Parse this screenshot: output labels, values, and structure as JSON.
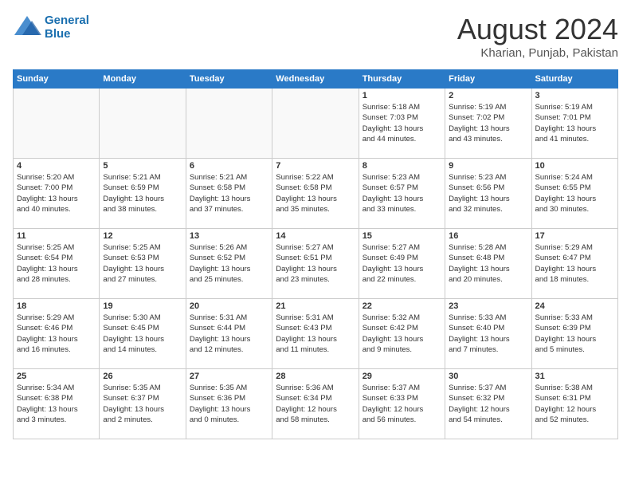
{
  "header": {
    "logo_line1": "General",
    "logo_line2": "Blue",
    "month_title": "August 2024",
    "location": "Kharian, Punjab, Pakistan"
  },
  "weekdays": [
    "Sunday",
    "Monday",
    "Tuesday",
    "Wednesday",
    "Thursday",
    "Friday",
    "Saturday"
  ],
  "weeks": [
    [
      {
        "day": "",
        "info": ""
      },
      {
        "day": "",
        "info": ""
      },
      {
        "day": "",
        "info": ""
      },
      {
        "day": "",
        "info": ""
      },
      {
        "day": "1",
        "info": "Sunrise: 5:18 AM\nSunset: 7:03 PM\nDaylight: 13 hours\nand 44 minutes."
      },
      {
        "day": "2",
        "info": "Sunrise: 5:19 AM\nSunset: 7:02 PM\nDaylight: 13 hours\nand 43 minutes."
      },
      {
        "day": "3",
        "info": "Sunrise: 5:19 AM\nSunset: 7:01 PM\nDaylight: 13 hours\nand 41 minutes."
      }
    ],
    [
      {
        "day": "4",
        "info": "Sunrise: 5:20 AM\nSunset: 7:00 PM\nDaylight: 13 hours\nand 40 minutes."
      },
      {
        "day": "5",
        "info": "Sunrise: 5:21 AM\nSunset: 6:59 PM\nDaylight: 13 hours\nand 38 minutes."
      },
      {
        "day": "6",
        "info": "Sunrise: 5:21 AM\nSunset: 6:58 PM\nDaylight: 13 hours\nand 37 minutes."
      },
      {
        "day": "7",
        "info": "Sunrise: 5:22 AM\nSunset: 6:58 PM\nDaylight: 13 hours\nand 35 minutes."
      },
      {
        "day": "8",
        "info": "Sunrise: 5:23 AM\nSunset: 6:57 PM\nDaylight: 13 hours\nand 33 minutes."
      },
      {
        "day": "9",
        "info": "Sunrise: 5:23 AM\nSunset: 6:56 PM\nDaylight: 13 hours\nand 32 minutes."
      },
      {
        "day": "10",
        "info": "Sunrise: 5:24 AM\nSunset: 6:55 PM\nDaylight: 13 hours\nand 30 minutes."
      }
    ],
    [
      {
        "day": "11",
        "info": "Sunrise: 5:25 AM\nSunset: 6:54 PM\nDaylight: 13 hours\nand 28 minutes."
      },
      {
        "day": "12",
        "info": "Sunrise: 5:25 AM\nSunset: 6:53 PM\nDaylight: 13 hours\nand 27 minutes."
      },
      {
        "day": "13",
        "info": "Sunrise: 5:26 AM\nSunset: 6:52 PM\nDaylight: 13 hours\nand 25 minutes."
      },
      {
        "day": "14",
        "info": "Sunrise: 5:27 AM\nSunset: 6:51 PM\nDaylight: 13 hours\nand 23 minutes."
      },
      {
        "day": "15",
        "info": "Sunrise: 5:27 AM\nSunset: 6:49 PM\nDaylight: 13 hours\nand 22 minutes."
      },
      {
        "day": "16",
        "info": "Sunrise: 5:28 AM\nSunset: 6:48 PM\nDaylight: 13 hours\nand 20 minutes."
      },
      {
        "day": "17",
        "info": "Sunrise: 5:29 AM\nSunset: 6:47 PM\nDaylight: 13 hours\nand 18 minutes."
      }
    ],
    [
      {
        "day": "18",
        "info": "Sunrise: 5:29 AM\nSunset: 6:46 PM\nDaylight: 13 hours\nand 16 minutes."
      },
      {
        "day": "19",
        "info": "Sunrise: 5:30 AM\nSunset: 6:45 PM\nDaylight: 13 hours\nand 14 minutes."
      },
      {
        "day": "20",
        "info": "Sunrise: 5:31 AM\nSunset: 6:44 PM\nDaylight: 13 hours\nand 12 minutes."
      },
      {
        "day": "21",
        "info": "Sunrise: 5:31 AM\nSunset: 6:43 PM\nDaylight: 13 hours\nand 11 minutes."
      },
      {
        "day": "22",
        "info": "Sunrise: 5:32 AM\nSunset: 6:42 PM\nDaylight: 13 hours\nand 9 minutes."
      },
      {
        "day": "23",
        "info": "Sunrise: 5:33 AM\nSunset: 6:40 PM\nDaylight: 13 hours\nand 7 minutes."
      },
      {
        "day": "24",
        "info": "Sunrise: 5:33 AM\nSunset: 6:39 PM\nDaylight: 13 hours\nand 5 minutes."
      }
    ],
    [
      {
        "day": "25",
        "info": "Sunrise: 5:34 AM\nSunset: 6:38 PM\nDaylight: 13 hours\nand 3 minutes."
      },
      {
        "day": "26",
        "info": "Sunrise: 5:35 AM\nSunset: 6:37 PM\nDaylight: 13 hours\nand 2 minutes."
      },
      {
        "day": "27",
        "info": "Sunrise: 5:35 AM\nSunset: 6:36 PM\nDaylight: 13 hours\nand 0 minutes."
      },
      {
        "day": "28",
        "info": "Sunrise: 5:36 AM\nSunset: 6:34 PM\nDaylight: 12 hours\nand 58 minutes."
      },
      {
        "day": "29",
        "info": "Sunrise: 5:37 AM\nSunset: 6:33 PM\nDaylight: 12 hours\nand 56 minutes."
      },
      {
        "day": "30",
        "info": "Sunrise: 5:37 AM\nSunset: 6:32 PM\nDaylight: 12 hours\nand 54 minutes."
      },
      {
        "day": "31",
        "info": "Sunrise: 5:38 AM\nSunset: 6:31 PM\nDaylight: 12 hours\nand 52 minutes."
      }
    ]
  ]
}
